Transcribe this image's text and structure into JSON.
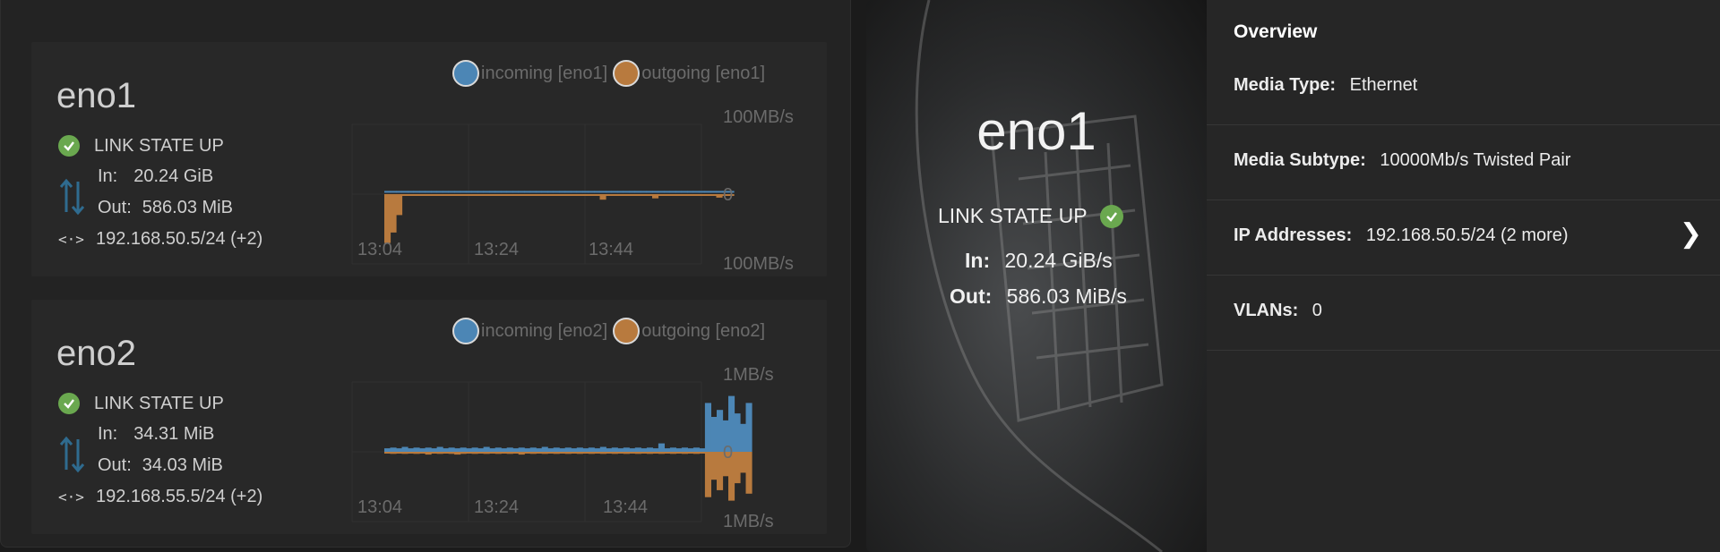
{
  "interfaces": [
    {
      "name": "eno1",
      "status": "LINK STATE UP",
      "in_label": "In:",
      "in_value": "20.24 GiB",
      "out_label": "Out:",
      "out_value": "586.03 MiB",
      "ip": "192.168.50.5/24 (+2)",
      "legend_in": "incoming [eno1]",
      "legend_out": "outgoing [eno1]",
      "y_top": "100MB/s",
      "y_mid": "0",
      "y_bottom": "100MB/s",
      "x_ticks": [
        "13:04",
        "13:24",
        "13:44"
      ],
      "chart_data": {
        "type": "area",
        "series": [
          {
            "name": "incoming [eno1]",
            "values": [
              2,
              2,
              2,
              2,
              2,
              2,
              2,
              2,
              2,
              2,
              2,
              2,
              2,
              2,
              2,
              2,
              2,
              2,
              2,
              2,
              2,
              2,
              2,
              2,
              2,
              2,
              2,
              2,
              2,
              2,
              2,
              2,
              2,
              2,
              2,
              2,
              2,
              2,
              2,
              2,
              2,
              2,
              2,
              2,
              2,
              2,
              2,
              2,
              2,
              2,
              2,
              2,
              2,
              2,
              2,
              2,
              2,
              2,
              2,
              2
            ]
          },
          {
            "name": "outgoing [eno1]",
            "values": [
              -70,
              -55,
              -30,
              0,
              0,
              0,
              0,
              0,
              0,
              0,
              0,
              0,
              0,
              0,
              0,
              0,
              0,
              0,
              0,
              0,
              0,
              0,
              0,
              0,
              0,
              0,
              0,
              0,
              0,
              0,
              0,
              0,
              0,
              0,
              0,
              0,
              0,
              -8,
              0,
              0,
              0,
              0,
              0,
              0,
              0,
              0,
              -6,
              0,
              0,
              0,
              0,
              0,
              0,
              0,
              0,
              0,
              0,
              -5,
              0,
              0
            ]
          }
        ],
        "y_unit": "MB/s",
        "ylim": [
          -100,
          100
        ]
      }
    },
    {
      "name": "eno2",
      "status": "LINK STATE UP",
      "in_label": "In:",
      "in_value": "34.31 MiB",
      "out_label": "Out:",
      "out_value": "34.03 MiB",
      "ip": "192.168.55.5/24 (+2)",
      "legend_in": "incoming [eno2]",
      "legend_out": "outgoing [eno2]",
      "y_top": "1MB/s",
      "y_mid": "0",
      "y_bottom": "1MB/s",
      "x_ticks": [
        "13:04",
        "13:24",
        "13:44"
      ],
      "chart_data": {
        "type": "area",
        "series": [
          {
            "name": "incoming [eno2]",
            "values": [
              0.05,
              0.06,
              0.05,
              0.07,
              0.05,
              0.06,
              0.05,
              0.06,
              0.05,
              0.07,
              0.05,
              0.06,
              0.05,
              0.06,
              0.05,
              0.06,
              0.05,
              0.07,
              0.05,
              0.06,
              0.05,
              0.06,
              0.05,
              0.06,
              0.05,
              0.06,
              0.05,
              0.07,
              0.05,
              0.06,
              0.05,
              0.06,
              0.05,
              0.06,
              0.05,
              0.06,
              0.05,
              0.07,
              0.05,
              0.06,
              0.05,
              0.06,
              0.05,
              0.06,
              0.05,
              0.06,
              0.05,
              0.12,
              0.05,
              0.06,
              0.05,
              0.06,
              0.05,
              0.06,
              0.05,
              0.7,
              0.5,
              0.6,
              0.45,
              0.8,
              0.55,
              0.4,
              0.7
            ]
          },
          {
            "name": "outgoing [eno2]",
            "values": [
              -0.02,
              -0.03,
              -0.02,
              -0.03,
              -0.02,
              -0.03,
              -0.02,
              -0.04,
              -0.02,
              -0.03,
              -0.02,
              -0.03,
              -0.04,
              -0.03,
              -0.02,
              -0.03,
              -0.02,
              -0.03,
              -0.02,
              -0.03,
              -0.02,
              -0.03,
              -0.02,
              -0.04,
              -0.02,
              -0.03,
              -0.02,
              -0.03,
              -0.02,
              -0.03,
              -0.02,
              -0.03,
              -0.02,
              -0.03,
              -0.02,
              -0.03,
              -0.02,
              -0.03,
              -0.02,
              -0.03,
              -0.02,
              -0.03,
              -0.02,
              -0.03,
              -0.02,
              -0.03,
              -0.02,
              -0.03,
              -0.02,
              -0.03,
              -0.02,
              -0.03,
              -0.02,
              -0.03,
              -0.02,
              -0.65,
              -0.4,
              -0.55,
              -0.35,
              -0.7,
              -0.45,
              -0.3,
              -0.6
            ]
          }
        ],
        "y_unit": "MB/s",
        "ylim": [
          -1,
          1
        ]
      }
    }
  ],
  "detail": {
    "name": "eno1",
    "status": "LINK STATE UP",
    "in_label": "In:",
    "in_value": "20.24 GiB/s",
    "out_label": "Out:",
    "out_value": "586.03 MiB/s"
  },
  "overview": {
    "title": "Overview",
    "rows": [
      {
        "label": "Media Type:",
        "value": "Ethernet"
      },
      {
        "label": "Media Subtype:",
        "value": "10000Mb/s Twisted Pair"
      },
      {
        "label": "IP Addresses:",
        "value": "192.168.50.5/24 (2 more)"
      },
      {
        "label": "VLANs:",
        "value": "0"
      }
    ]
  },
  "colors": {
    "incoming": "#4c86b5",
    "outgoing": "#b87a3e",
    "status_ok": "#6aa84f",
    "arrow": "#2f6b8f"
  },
  "icons": [
    "check-circle-icon",
    "transfer-arrows-icon",
    "ip-address-icon",
    "chevron-right-icon"
  ]
}
